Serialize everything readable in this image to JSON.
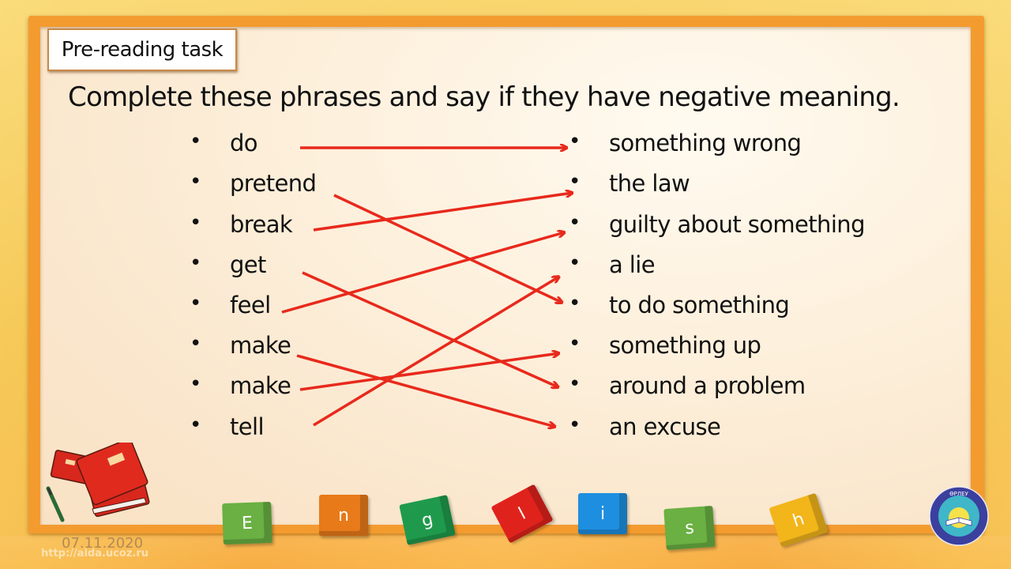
{
  "slide": {
    "label": "Pre-reading task",
    "title": "Complete these phrases and say if they have negative meaning.",
    "date": "07.11.2020",
    "watermark": "http://aida.ucoz.ru",
    "bullet_char": "•"
  },
  "left_items": [
    {
      "text": "do"
    },
    {
      "text": "pretend"
    },
    {
      "text": "break"
    },
    {
      "text": "get"
    },
    {
      "text": "feel"
    },
    {
      "text": "make"
    },
    {
      "text": "make"
    },
    {
      "text": "tell"
    }
  ],
  "right_items": [
    {
      "text": "something wrong"
    },
    {
      "text": "the law"
    },
    {
      "text": "guilty about something"
    },
    {
      "text": "a lie"
    },
    {
      "text": "to do something"
    },
    {
      "text": "something up"
    },
    {
      "text": "around a problem"
    },
    {
      "text": "an excuse"
    }
  ],
  "matches": [
    {
      "from": 0,
      "to": 0
    },
    {
      "from": 1,
      "to": 4
    },
    {
      "from": 2,
      "to": 1
    },
    {
      "from": 3,
      "to": 6
    },
    {
      "from": 4,
      "to": 2
    },
    {
      "from": 5,
      "to": 7
    },
    {
      "from": 6,
      "to": 5
    },
    {
      "from": 7,
      "to": 3
    }
  ],
  "colors": {
    "arrow": "#e8291c",
    "frame": "#f39b2e",
    "text": "#111111"
  },
  "cubes": [
    {
      "letter": "E",
      "color": "#6ab042",
      "icon": "letter-cube-icon"
    },
    {
      "letter": "n",
      "color": "#e87a1a",
      "icon": "letter-cube-icon"
    },
    {
      "letter": "g",
      "color": "#1f9a4c",
      "icon": "letter-cube-icon"
    },
    {
      "letter": "l",
      "color": "#e0221c",
      "icon": "letter-cube-icon"
    },
    {
      "letter": "i",
      "color": "#1e8fe0",
      "icon": "letter-cube-icon"
    },
    {
      "letter": "s",
      "color": "#6ab042",
      "icon": "letter-cube-icon"
    },
    {
      "letter": "h",
      "color": "#f2b51a",
      "icon": "letter-cube-icon"
    }
  ],
  "decorations": {
    "books_icon": "red-books-and-pen-icon",
    "logo_icon": "orleu-emblem-icon",
    "logo_text": "ӨРЛЕУ"
  }
}
